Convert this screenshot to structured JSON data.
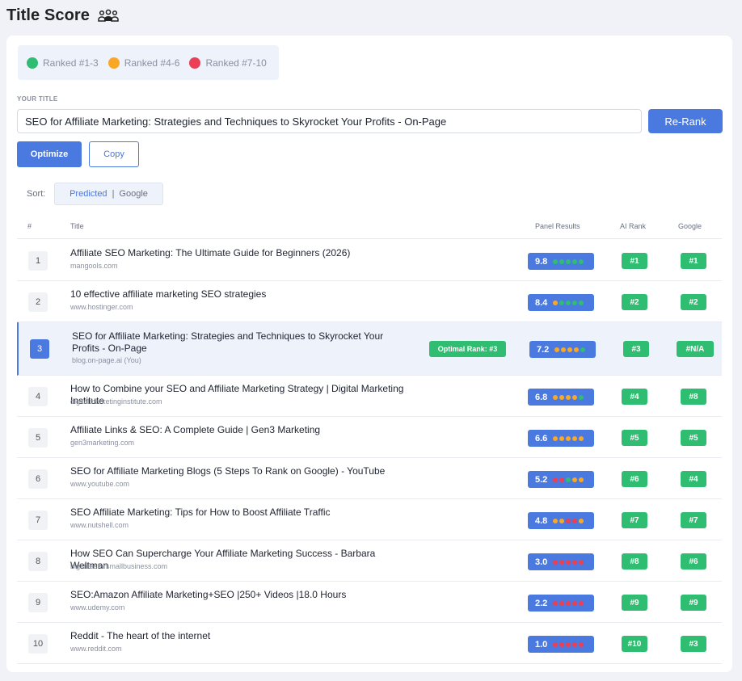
{
  "page": {
    "title": "Title Score",
    "icon": "team-icon"
  },
  "legend": [
    {
      "label": "Ranked #1-3",
      "color": "#2fbd72"
    },
    {
      "label": "Ranked #4-6",
      "color": "#f9a825"
    },
    {
      "label": "Ranked #7-10",
      "color": "#ec3e55"
    }
  ],
  "form": {
    "label": "YOUR TITLE",
    "value": "SEO for Affiliate Marketing: Strategies and Techniques to Skyrocket Your Profits - On-Page",
    "rerank": "Re-Rank",
    "optimize": "Optimize",
    "copy": "Copy"
  },
  "sort": {
    "label": "Sort:",
    "predicted": "Predicted",
    "separator": "|",
    "google": "Google",
    "active": "Predicted"
  },
  "columns": {
    "num": "#",
    "title": "Title",
    "panel": "Panel Results",
    "ai": "AI Rank",
    "google": "Google"
  },
  "colors": {
    "green": "#2fbd72",
    "orange": "#f9a825",
    "red": "#ec3e55",
    "accent": "#4a79e0"
  },
  "rows": [
    {
      "num": "1",
      "title": "Affiliate SEO Marketing: The Ultimate Guide for Beginners (2026)",
      "domain": "mangools.com",
      "score": "9.8",
      "dots": [
        "g",
        "g",
        "g",
        "g",
        "g"
      ],
      "ai": "#1",
      "google": "#1"
    },
    {
      "num": "2",
      "title": "10 effective affiliate marketing SEO strategies",
      "domain": "www.hostinger.com",
      "score": "8.4",
      "dots": [
        "o",
        "g",
        "g",
        "g",
        "g"
      ],
      "ai": "#2",
      "google": "#2"
    },
    {
      "num": "3",
      "title": "SEO for Affiliate Marketing: Strategies and Techniques to Skyrocket Your Profits - On-Page",
      "domain": "blog.on-page.ai (You)",
      "score": "7.2",
      "dots": [
        "o",
        "o",
        "o",
        "o",
        "g"
      ],
      "ai": "#3",
      "google": "#N/A",
      "optimal": "Optimal Rank: #3",
      "highlight": true
    },
    {
      "num": "4",
      "title": "How to Combine your SEO and Affiliate Marketing Strategy | Digital Marketing Institute",
      "domain": "digitalmarketinginstitute.com",
      "score": "6.8",
      "dots": [
        "o",
        "o",
        "o",
        "o",
        "g"
      ],
      "ai": "#4",
      "google": "#8"
    },
    {
      "num": "5",
      "title": "Affiliate Links & SEO: A Complete Guide | Gen3 Marketing",
      "domain": "gen3marketing.com",
      "score": "6.6",
      "dots": [
        "o",
        "o",
        "o",
        "o",
        "o"
      ],
      "ai": "#5",
      "google": "#5"
    },
    {
      "num": "6",
      "title": "SEO for Affiliate Marketing Blogs (5 Steps To Rank on Google) - YouTube",
      "domain": "www.youtube.com",
      "score": "5.2",
      "dots": [
        "r",
        "r",
        "g",
        "o",
        "o"
      ],
      "ai": "#6",
      "google": "#4"
    },
    {
      "num": "7",
      "title": "SEO Affiliate Marketing: Tips for How to Boost Affiliate Traffic",
      "domain": "www.nutshell.com",
      "score": "4.8",
      "dots": [
        "o",
        "o",
        "r",
        "r",
        "o"
      ],
      "ai": "#7",
      "google": "#7"
    },
    {
      "num": "8",
      "title": "How SEO Can Supercharge Your Affiliate Marketing Success - Barbara Weltman",
      "domain": "bigideasforsmallbusiness.com",
      "score": "3.0",
      "dots": [
        "r",
        "r",
        "r",
        "r",
        "r"
      ],
      "ai": "#8",
      "google": "#6"
    },
    {
      "num": "9",
      "title": "SEO:Amazon Affiliate Marketing+SEO |250+ Videos |18.0 Hours",
      "domain": "www.udemy.com",
      "score": "2.2",
      "dots": [
        "r",
        "r",
        "r",
        "r",
        "r"
      ],
      "ai": "#9",
      "google": "#9"
    },
    {
      "num": "10",
      "title": "Reddit - The heart of the internet",
      "domain": "www.reddit.com",
      "score": "1.0",
      "dots": [
        "r",
        "r",
        "r",
        "r",
        "r"
      ],
      "ai": "#10",
      "google": "#3"
    }
  ]
}
